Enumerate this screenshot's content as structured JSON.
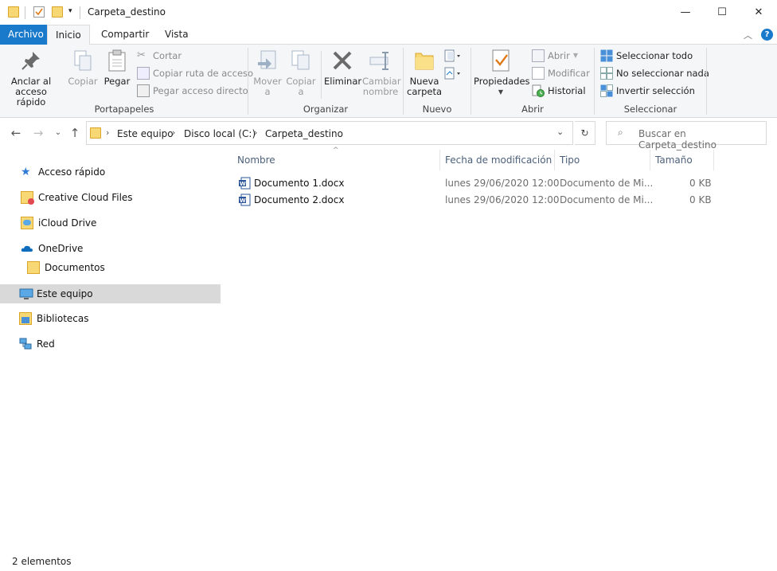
{
  "window": {
    "title": "Carpeta_destino",
    "minimize": "—",
    "maximize": "☐",
    "close": "✕"
  },
  "tabs": [
    "Archivo",
    "Inicio",
    "Compartir",
    "Vista"
  ],
  "ribbon": {
    "portapapeles": {
      "label": "Portapapeles",
      "anclar": "Anclar al acceso rápido",
      "copiar": "Copiar",
      "pegar": "Pegar",
      "cortar": "Cortar",
      "copiar_ruta": "Copiar ruta de acceso",
      "pegar_acceso": "Pegar acceso directo"
    },
    "organizar": {
      "label": "Organizar",
      "mover": "Mover a",
      "copiar": "Copiar a",
      "eliminar": "Eliminar",
      "cambiar": "Cambiar nombre"
    },
    "nuevo": {
      "label": "Nuevo",
      "nueva_carpeta": "Nueva carpeta"
    },
    "abrir": {
      "label": "Abrir",
      "propiedades": "Propiedades",
      "abrir": "Abrir",
      "modificar": "Modificar",
      "historial": "Historial"
    },
    "seleccionar": {
      "label": "Seleccionar",
      "todo": "Seleccionar todo",
      "nada": "No seleccionar nada",
      "invertir": "Invertir selección"
    }
  },
  "address": {
    "crumbs": [
      "Este equipo",
      "Disco local (C:)",
      "Carpeta_destino"
    ],
    "search_placeholder": "Buscar en Carpeta_destino"
  },
  "nav_pane": [
    "Acceso rápido",
    "Creative Cloud Files",
    "iCloud Drive",
    "OneDrive",
    "Documentos",
    "Este equipo",
    "Bibliotecas",
    "Red"
  ],
  "columns": [
    "Nombre",
    "Fecha de modificación",
    "Tipo",
    "Tamaño"
  ],
  "files": [
    {
      "name": "Documento 1.docx",
      "date": "lunes 29/06/2020 12:00",
      "type": "Documento de Mi...",
      "size": "0 KB"
    },
    {
      "name": "Documento 2.docx",
      "date": "lunes 29/06/2020 12:00",
      "type": "Documento de Mi...",
      "size": "0 KB"
    }
  ],
  "status": "2 elementos",
  "colors": {
    "accent": "#1979ca",
    "selected_nav": "#d9d9d9",
    "folder": "#f8d775",
    "word": "#2b579a"
  }
}
